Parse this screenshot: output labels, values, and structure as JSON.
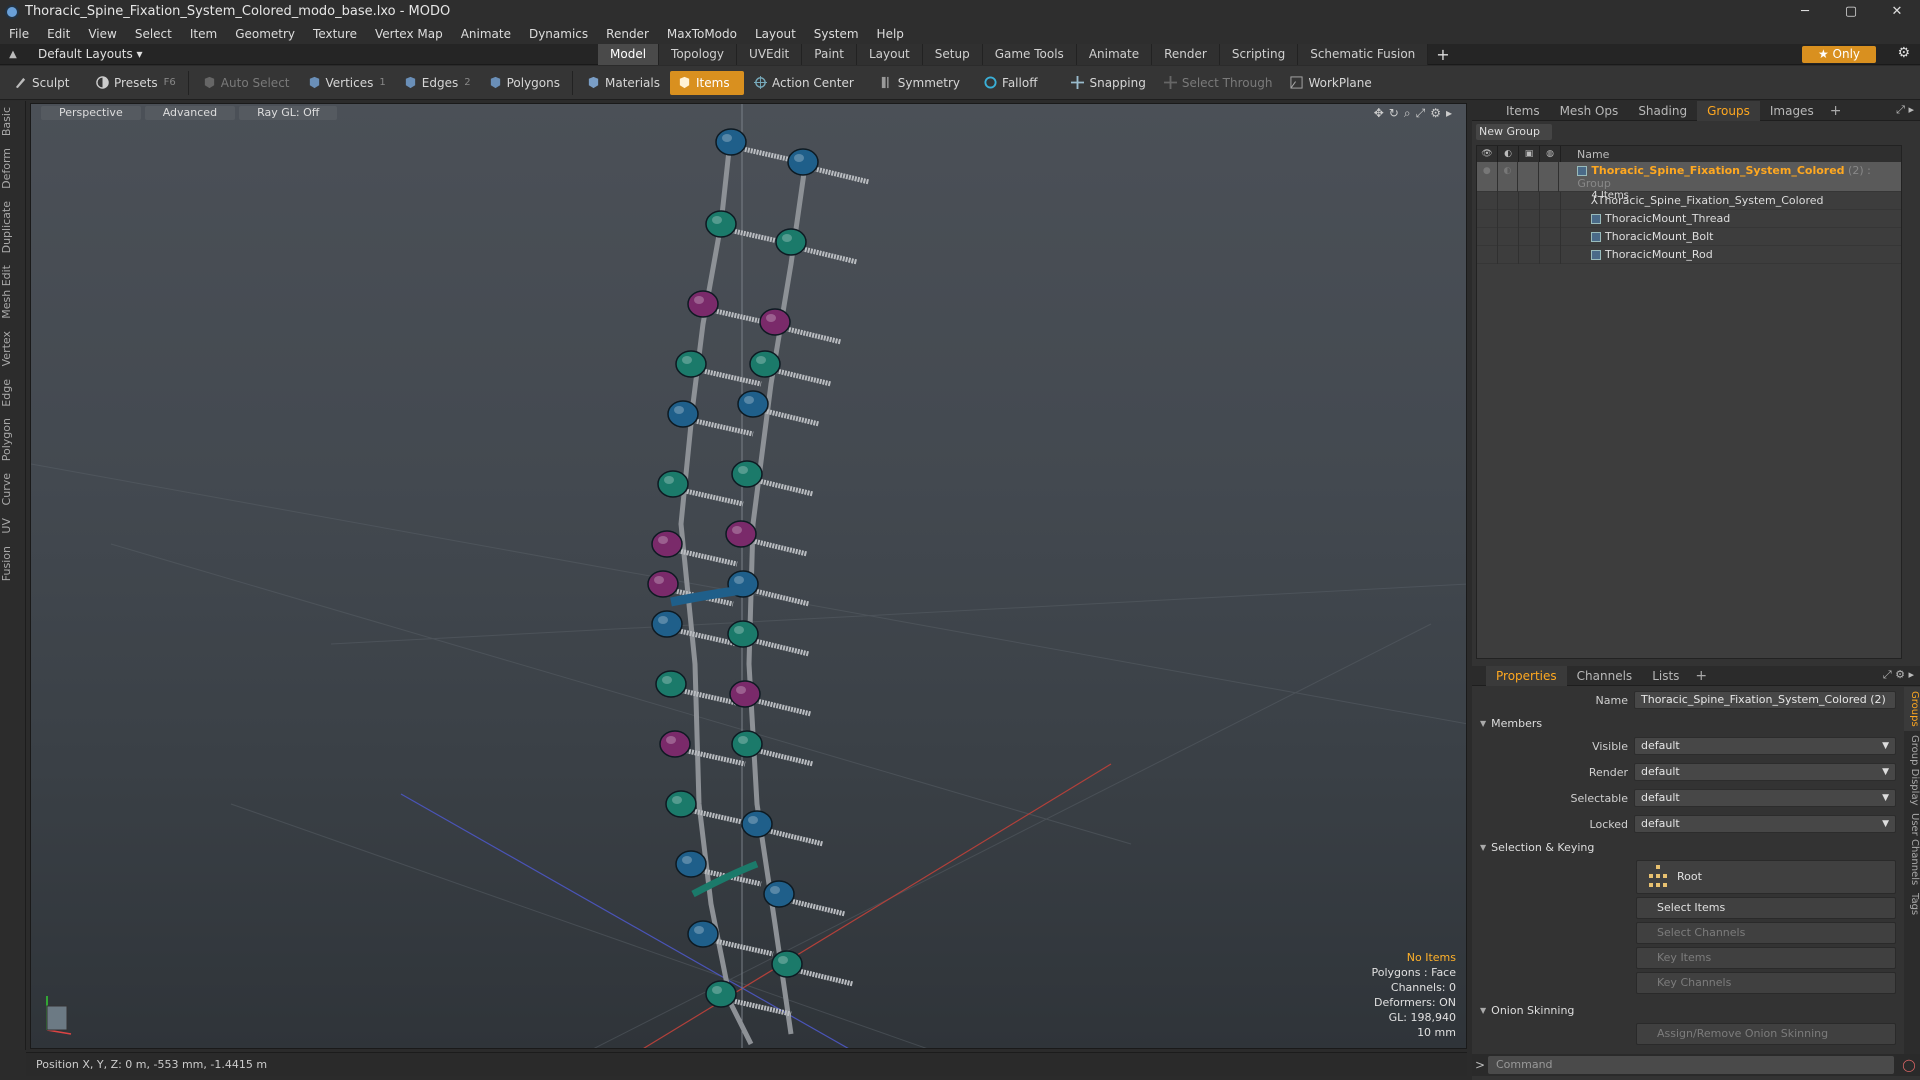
{
  "window": {
    "title": "Thoracic_Spine_Fixation_System_Colored_modo_base.lxo - MODO",
    "minimize": "─",
    "maximize": "▢",
    "close": "✕"
  },
  "menu": [
    "File",
    "Edit",
    "View",
    "Select",
    "Item",
    "Geometry",
    "Texture",
    "Vertex Map",
    "Animate",
    "Dynamics",
    "Render",
    "MaxToModo",
    "Layout",
    "System",
    "Help"
  ],
  "layoutbar": {
    "selector": "Default Layouts ▾",
    "tabs": [
      "Model",
      "Topology",
      "UVEdit",
      "Paint",
      "Layout",
      "Setup",
      "Game Tools",
      "Animate",
      "Render",
      "Scripting",
      "Schematic Fusion"
    ],
    "plus": "+",
    "only": "★ Only",
    "gear": "⚙"
  },
  "toolbar": {
    "sculpt": "Sculpt",
    "presets": "Presets",
    "presets_key": "F6",
    "auto_select": "Auto Select",
    "vertices": "Vertices",
    "vertices_key": "1",
    "edges": "Edges",
    "edges_key": "2",
    "polygons": "Polygons",
    "materials": "Materials",
    "items": "Items",
    "action_center": "Action Center",
    "symmetry": "Symmetry",
    "falloff": "Falloff",
    "snapping": "Snapping",
    "select_through": "Select Through",
    "workplane": "WorkPlane"
  },
  "left_tabs": [
    "Basic",
    "Deform",
    "Duplicate",
    "Mesh Edit",
    "Vertex",
    "Edge",
    "Polygon",
    "Curve",
    "UV",
    "Fusion"
  ],
  "viewport": {
    "perspective": "Perspective",
    "advanced": "Advanced",
    "raygl": "Ray GL: Off",
    "info": {
      "no_items": "No Items",
      "polygons": "Polygons : Face",
      "channels": "Channels: 0",
      "deformers": "Deformers: ON",
      "gl": "GL: 198,940",
      "scale": "10 mm"
    }
  },
  "status": {
    "position": "Position X, Y, Z:  0 m, -553 mm, -1.4415 m"
  },
  "groups_panel": {
    "tabs": [
      "Items",
      "Mesh Ops",
      "Shading",
      "Groups",
      "Images"
    ],
    "plus": "+",
    "new_group": "New Group",
    "name_col": "Name",
    "group": {
      "name": "Thoracic_Spine_Fixation_System_Colored",
      "suffix": "(2) : Group",
      "count": "4 Items"
    },
    "members": [
      "Thoracic_Spine_Fixation_System_Colored",
      "ThoracicMount_Thread",
      "ThoracicMount_Bolt",
      "ThoracicMount_Rod"
    ]
  },
  "properties": {
    "tabs": [
      "Properties",
      "Channels",
      "Lists"
    ],
    "plus": "+",
    "name_label": "Name",
    "name_value": "Thoracic_Spine_Fixation_System_Colored (2)",
    "members_section": "Members",
    "visible_label": "Visible",
    "visible_value": "default",
    "render_label": "Render",
    "render_value": "default",
    "selectable_label": "Selectable",
    "selectable_value": "default",
    "locked_label": "Locked",
    "locked_value": "default",
    "selkey_section": "Selection & Keying",
    "root": "Root",
    "select_items": "Select Items",
    "select_channels": "Select Channels",
    "key_items": "Key Items",
    "key_channels": "Key Channels",
    "onion_section": "Onion Skinning",
    "onion_btn": "Assign/Remove Onion Skinning",
    "side_tabs": [
      "Groups",
      "Group Display",
      "User Channels",
      "Tags"
    ]
  },
  "command": {
    "prompt": ">",
    "placeholder": "Command"
  },
  "colors": {
    "accent": "#d9901f",
    "active_text": "#ffa820",
    "screw_blue": "#1f5f8a",
    "screw_teal": "#1b7a6a",
    "screw_purple": "#7a2a6a"
  }
}
